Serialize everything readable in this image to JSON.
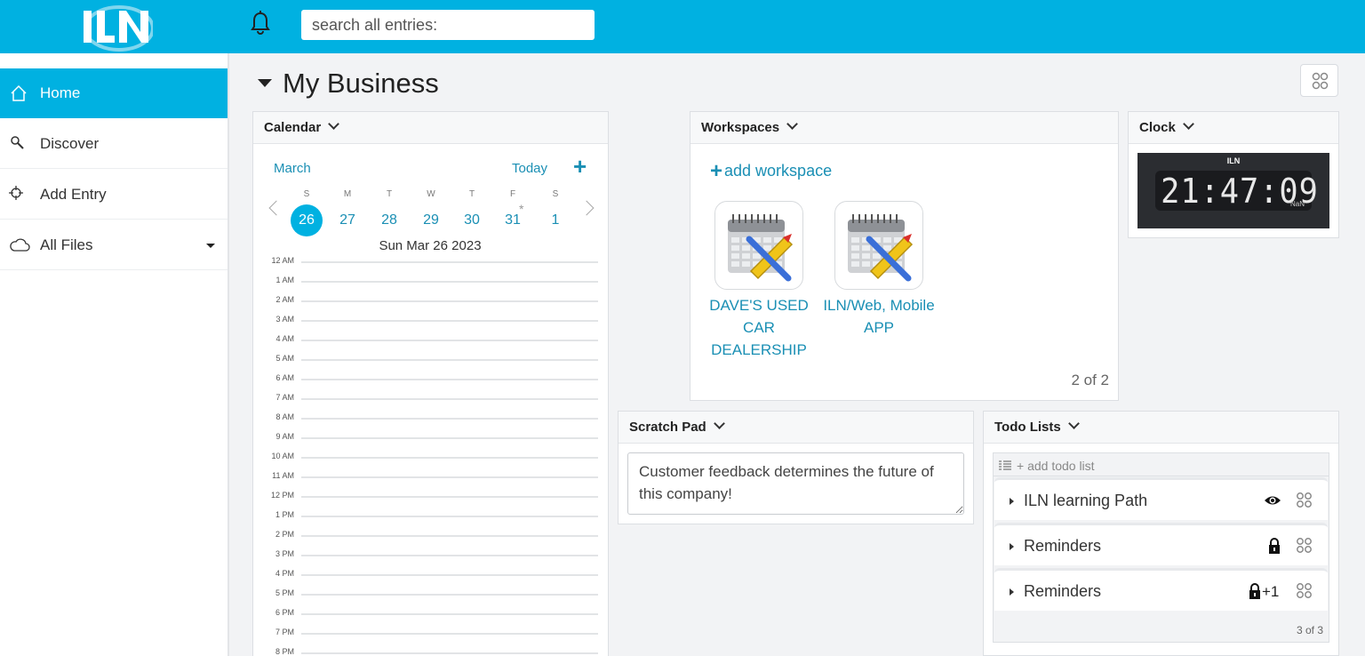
{
  "app": {
    "logo_text": "ILN",
    "search_placeholder": "search all entries:"
  },
  "sidebar": {
    "items": [
      {
        "label": "Home",
        "icon": "home-icon",
        "active": true
      },
      {
        "label": "Discover",
        "icon": "magnifier-icon"
      },
      {
        "label": "Add Entry",
        "icon": "crosshair-icon"
      },
      {
        "label": "All Files",
        "icon": "cloud-icon",
        "has_dropdown": true
      }
    ]
  },
  "page": {
    "title": "My Business"
  },
  "calendar": {
    "title": "Calendar",
    "month": "March",
    "today_label": "Today",
    "add_label": "+",
    "day_names": [
      "S",
      "M",
      "T",
      "W",
      "T",
      "F",
      "S"
    ],
    "days": [
      "26",
      "27",
      "28",
      "29",
      "30",
      "31",
      "1"
    ],
    "selected_index": 0,
    "asterisk_mark": "*",
    "selected_date": "Sun Mar 26 2023",
    "hours": [
      "12 AM",
      "1 AM",
      "2 AM",
      "3 AM",
      "4 AM",
      "5 AM",
      "6 AM",
      "7 AM",
      "8 AM",
      "9 AM",
      "10 AM",
      "11 AM",
      "12 PM",
      "1 PM",
      "2 PM",
      "3 PM",
      "4 PM",
      "5 PM",
      "6 PM",
      "7 PM",
      "8 PM"
    ]
  },
  "workspaces": {
    "title": "Workspaces",
    "add_label": "add workspace",
    "add_plus": "+",
    "items": [
      {
        "name": "DAVE'S USED CAR DEALERSHIP"
      },
      {
        "name": "ILN/Web, Mobile APP"
      }
    ],
    "count": "2 of 2"
  },
  "clock": {
    "title": "Clock",
    "time": "21:47:09",
    "sub": "NaN",
    "logo": "ILN"
  },
  "scratch": {
    "title": "Scratch Pad",
    "text": "Customer feedback determines the future of this company!"
  },
  "todo": {
    "title": "Todo Lists",
    "add_label": "+ add todo list",
    "items": [
      {
        "label": "ILN learning Path",
        "icon": "eye-icon"
      },
      {
        "label": "Reminders",
        "icon": "lock-icon"
      },
      {
        "label": "Reminders",
        "icon": "lock-icon",
        "extra": "+1"
      }
    ],
    "count": "3 of 3"
  },
  "colors": {
    "brand": "#00b1e1",
    "link": "#1a8fb4"
  }
}
